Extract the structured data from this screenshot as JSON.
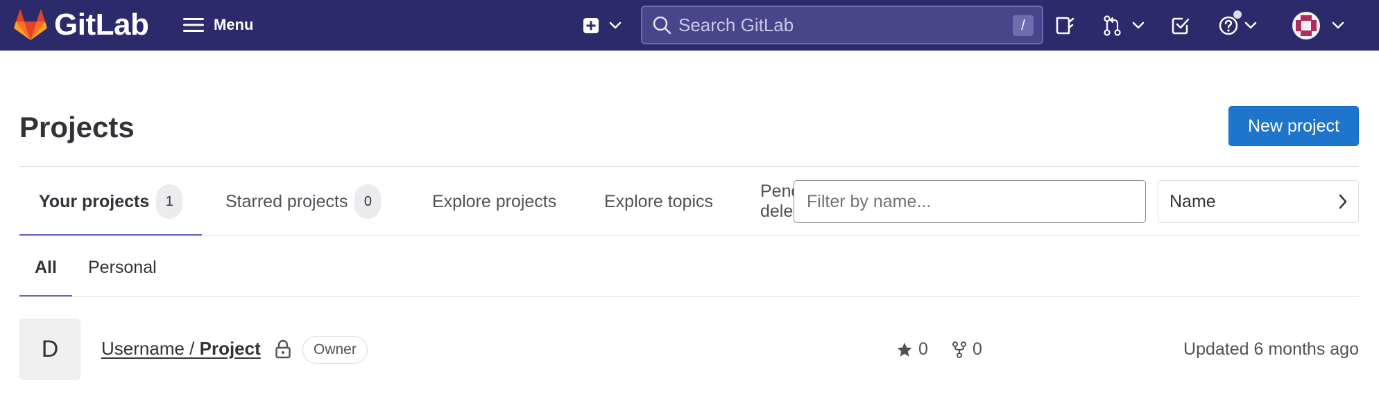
{
  "header": {
    "brand": "GitLab",
    "menu_label": "Menu",
    "search_placeholder": "Search GitLab",
    "search_shortcut": "/",
    "colors": {
      "topbar": "#2b2a6b",
      "logo_orange": "#fc6d26"
    },
    "icons": [
      "gitlab-logo-icon",
      "hamburger-icon",
      "plus-square-icon",
      "chevron-down-icon",
      "search-icon",
      "issues-icon",
      "merge-request-icon",
      "todo-icon",
      "help-icon",
      "avatar-icon"
    ]
  },
  "page": {
    "title": "Projects",
    "new_project_label": "New project"
  },
  "tabs": [
    {
      "label": "Your projects",
      "count": "1"
    },
    {
      "label": "Starred projects",
      "count": "0"
    },
    {
      "label": "Explore projects"
    },
    {
      "label": "Explore topics"
    },
    {
      "label": "Pending deletion"
    }
  ],
  "filter": {
    "placeholder": "Filter by name...",
    "sort_selected": "Name"
  },
  "subtabs": [
    {
      "label": "All"
    },
    {
      "label": "Personal"
    }
  ],
  "project": {
    "avatar_letter": "D",
    "namespace": "Username / ",
    "name": "Project",
    "role": "Owner",
    "stars": "0",
    "forks": "0",
    "updated": "Updated 6 months ago"
  }
}
